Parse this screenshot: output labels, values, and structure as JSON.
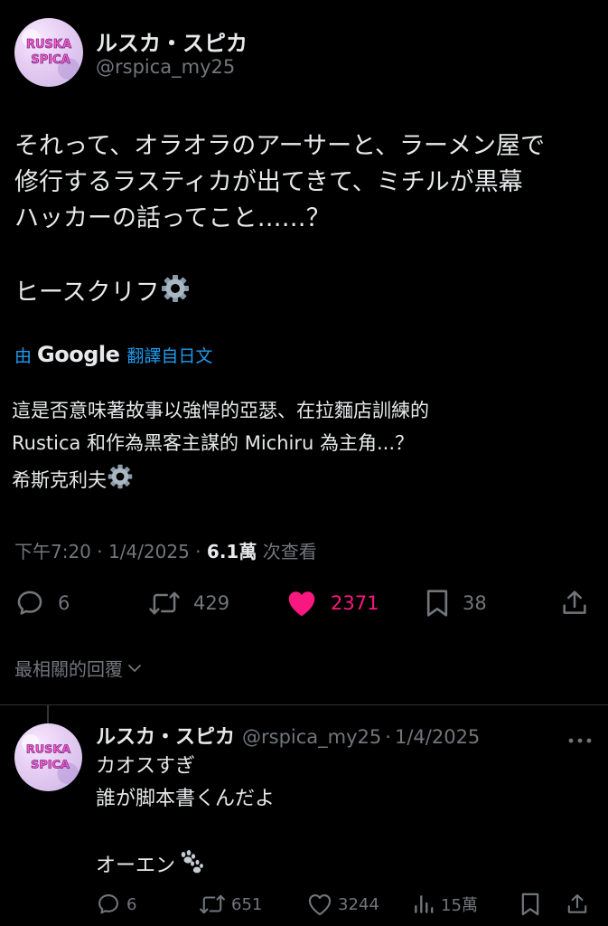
{
  "tweet": {
    "author_name": "ルスカ・スピカ",
    "author_handle": "@rspica_my25",
    "avatar_text_1": "RUSKA",
    "avatar_text_2": "SPICA",
    "text_lines": [
      "それって、オラオラのアーサーと、ラーメン屋で",
      "修行するラスティカが出てきて、ミチルが黒幕",
      "ハッカーの話ってこと……？"
    ],
    "signature": "ヒースクリフ",
    "translate": {
      "by": "由",
      "google": "Google",
      "from": "翻譯自日文"
    },
    "translated_lines": [
      "這是否意味著故事以強悍的亞瑟、在拉麵店訓練的",
      "Rustica 和作為黑客主謀的 Michiru 為主角...？"
    ],
    "translated_signature": "希斯克利夫",
    "meta": {
      "time": "下午7:20",
      "sep": " · ",
      "date": "1/4/2025",
      "views": "6.1萬",
      "views_label": " 次查看"
    },
    "actions": {
      "replies": "6",
      "reposts": "429",
      "likes": "2371",
      "bookmarks": "38"
    },
    "colors": {
      "like": "#f91880",
      "link": "#1d9bf0",
      "muted": "#71767b"
    }
  },
  "best_replies_label": "最相關的回覆",
  "reply": {
    "author_name": "ルスカ・スピカ",
    "author_handle": "@rspica_my25",
    "sep": "·",
    "date": "1/4/2025",
    "lines": [
      "カオスすぎ",
      "誰が脚本書くんだよ"
    ],
    "signature": "オーエン",
    "actions": {
      "replies": "6",
      "reposts": "651",
      "likes": "3244",
      "views": "15萬"
    }
  }
}
